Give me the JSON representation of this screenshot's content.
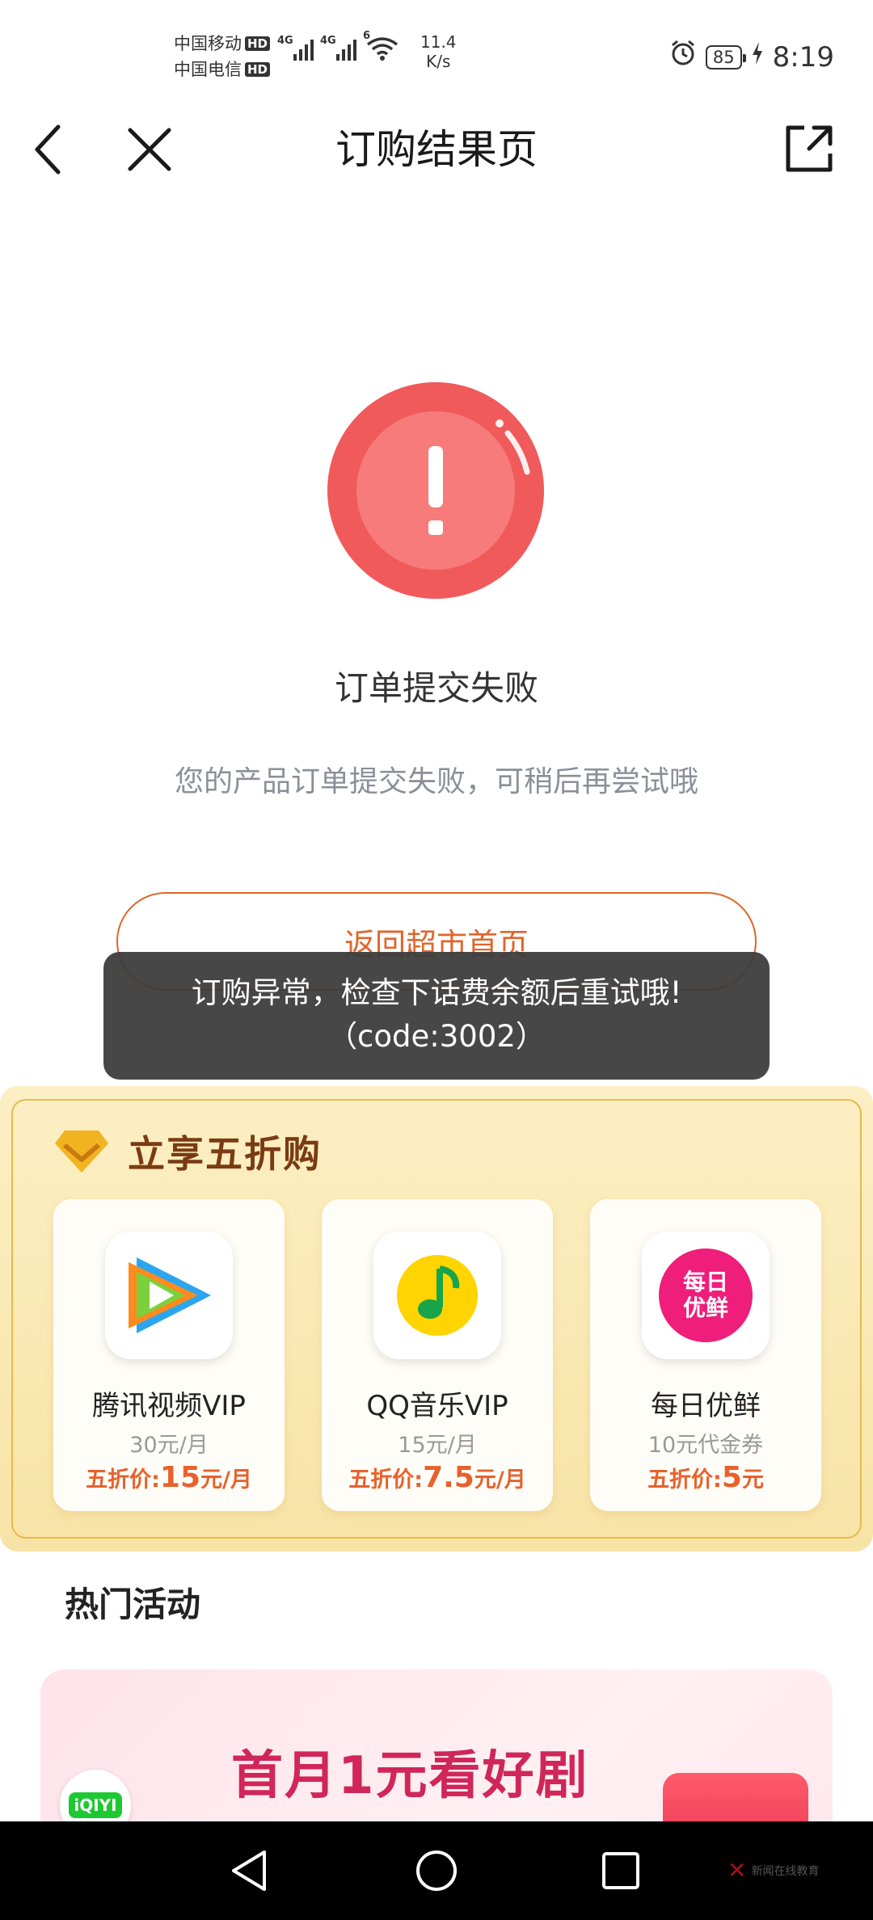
{
  "status_bar": {
    "carrier1": "中国移动",
    "carrier2": "中国电信",
    "hd": "HD",
    "net1": "4G",
    "net2": "4G",
    "wifi_badge": "6",
    "speed_value": "11.4",
    "speed_unit": "K/s",
    "battery": "85",
    "time": "8:19"
  },
  "nav": {
    "title": "订购结果页",
    "back_icon": "chevron-left-icon",
    "close_icon": "close-icon",
    "share_icon": "share-icon"
  },
  "result": {
    "title": "订单提交失败",
    "description": "您的产品订单提交失败，可稍后再尝试哦",
    "home_button": "返回超市首页",
    "icon": "error-exclamation-icon",
    "accent_color": "#f05a5a"
  },
  "toast": {
    "line1": "订购异常，检查下话费余额后重试哦!",
    "line2": "（code:3002）"
  },
  "promo": {
    "title": "立享五折购",
    "cards": [
      {
        "name": "腾讯视频VIP",
        "price": "30元/月",
        "deal_prefix": "五折价:",
        "deal_value": "15",
        "deal_suffix": "元/月",
        "icon": "tencent-video-icon"
      },
      {
        "name": "QQ音乐VIP",
        "price": "15元/月",
        "deal_prefix": "五折价:",
        "deal_value": "7.5",
        "deal_suffix": "元/月",
        "icon": "qq-music-icon"
      },
      {
        "name": "每日优鲜",
        "price": "10元代金券",
        "deal_prefix": "五折价:",
        "deal_value": "5",
        "deal_suffix": "元",
        "icon": "missfresh-icon",
        "icon_text1": "每日",
        "icon_text2": "优鲜"
      }
    ]
  },
  "hot": {
    "title": "热门活动",
    "banner_text": "首月1元看好剧",
    "banner_logo": "iQIYI"
  },
  "watermark": "新闻在线教育"
}
